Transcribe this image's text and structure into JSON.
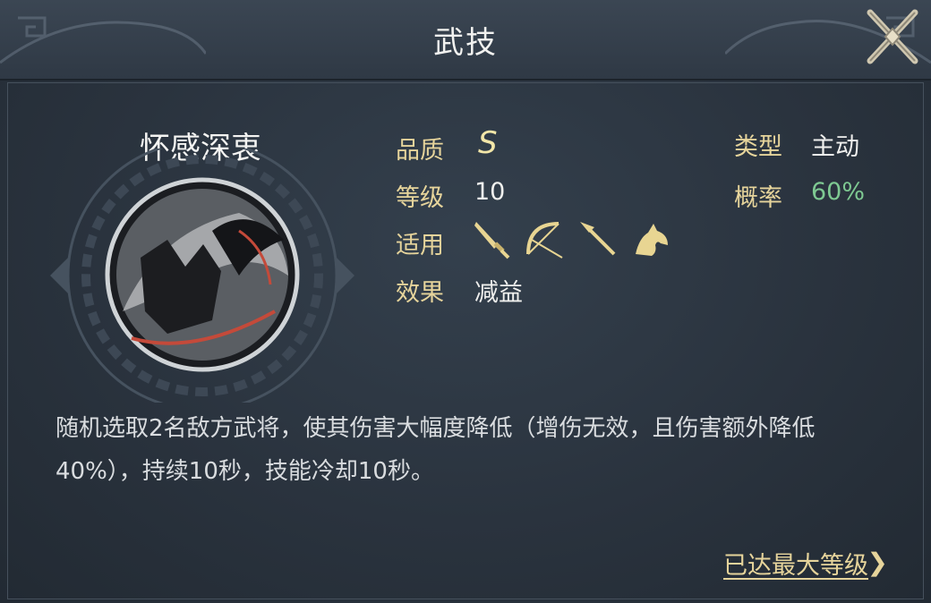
{
  "header": {
    "title": "武技"
  },
  "skill": {
    "name": "怀感深衷",
    "quality_label": "品质",
    "quality_value": "S",
    "level_label": "等级",
    "level_value": "10",
    "applies_label": "适用",
    "applies_icons": [
      "sword-icon",
      "bow-icon",
      "spear-icon",
      "horse-icon"
    ],
    "effect_label": "效果",
    "effect_value": "减益",
    "type_label": "类型",
    "type_value": "主动",
    "rate_label": "概率",
    "rate_value": "60%",
    "description": "随机选取2名敌方武将，使其伤害大幅度降低（增伤无效，且伤害额外降低40%），持续10秒，技能冷却10秒。"
  },
  "footer": {
    "max_level_label": "已达最大等级",
    "chevron": "❯"
  },
  "colors": {
    "background": "#2b3440",
    "label_gold": "#e6d49b",
    "rate_green": "#7ec992",
    "quality_gold": "#f2e6a8"
  }
}
